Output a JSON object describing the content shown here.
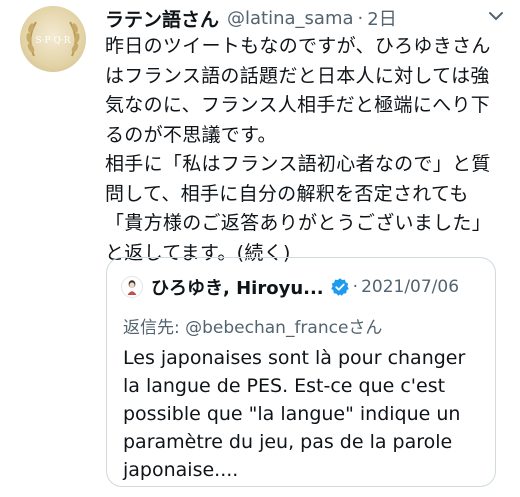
{
  "tweet": {
    "display_name": "ラテン語さん",
    "handle": "@latina_sama",
    "separator": "·",
    "time": "2日",
    "avatar_text": "S·P·Q·R",
    "text_lines": [
      "昨日のツイートもなのですが、ひろゆきさん",
      "はフランス語の話題だと日本人に対しては強",
      "気なのに、フランス人相手だと極端にへり下",
      "るのが不思議です。",
      "相手に「私はフランス語初心者なので」と質",
      "問して、相手に自分の解釈を否定されても",
      "「貴方様のご返答ありがとうございました」",
      "と返してます。(続く)"
    ]
  },
  "quoted": {
    "display_name": "ひろゆき, Hiroyu...",
    "separator": "·",
    "date": "2021/07/06",
    "reply_to": "返信先: @bebechan_franceさん",
    "text_lines": [
      "Les japonaises sont là pour changer",
      "la langue de PES. Est-ce que c'est",
      "possible que \"la langue\" indique un",
      "paramètre du jeu, pas de la parole",
      "japonaise...."
    ]
  },
  "colors": {
    "secondary": "#536471",
    "verified": "#1d9bf0",
    "border": "#cfd9de"
  }
}
